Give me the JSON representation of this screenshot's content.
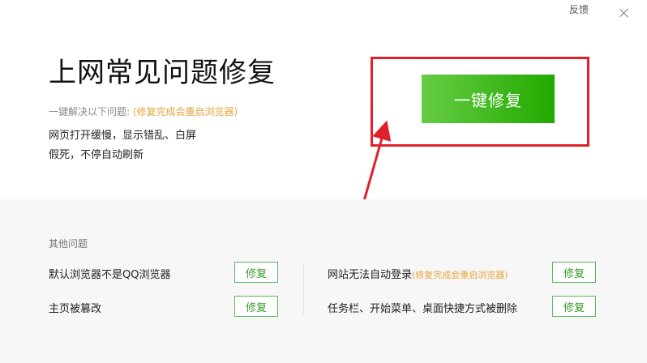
{
  "header": {
    "feedback_label": "反馈"
  },
  "main": {
    "title": "上网常见问题修复",
    "subline_prefix": "一键解决以下问题: ",
    "subline_note": "(修复完成会重启浏览器)",
    "desc_line1": "网页打开缓慢，显示错乱、白屏",
    "desc_line2": "假死，不停自动刷新",
    "primary_button": "一键修复"
  },
  "other": {
    "title": "其他问题",
    "items": [
      {
        "label": "默认浏览器不是QQ浏览器",
        "note": "",
        "button": "修复"
      },
      {
        "label": "网站无法自动登录",
        "note": "(修复完成会重启浏览器)",
        "button": "修复"
      },
      {
        "label": "主页被篡改",
        "note": "",
        "button": "修复"
      },
      {
        "label": "任务栏、开始菜单、桌面快捷方式被删除",
        "note": "",
        "button": "修复"
      }
    ]
  },
  "colors": {
    "accent_green": "#22aa00",
    "highlight_red": "#e0202a",
    "note_orange": "#e8a33d"
  }
}
